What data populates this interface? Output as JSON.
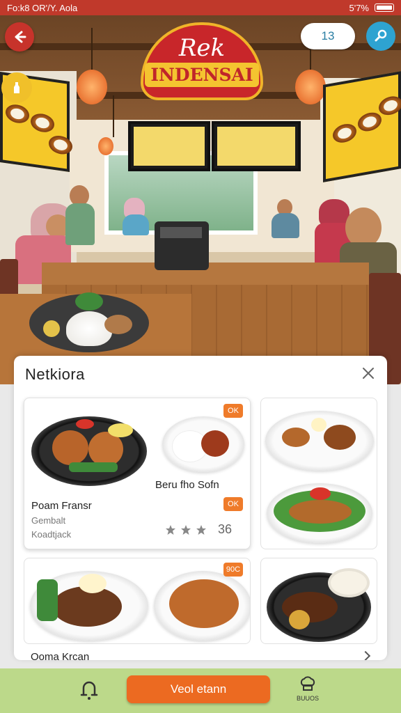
{
  "status_bar": {
    "left_text": "Fo:k8 OR'/Y. Aola",
    "right_text": "5'7%"
  },
  "header": {
    "logo_top": "Rek",
    "logo_bottom": "INDENSAI",
    "count": "13"
  },
  "panel": {
    "title": "Netkiora",
    "cards": [
      {
        "name": "Poam Fransr",
        "sub1": "Gembalt",
        "sub2": "Koadtjack",
        "secondary_name": "Beru fho Sofn",
        "rating": "36",
        "tag1": "OK",
        "tag2": "OK"
      },
      {
        "tag": "90C"
      }
    ],
    "cut_label": "Ooma Krcan"
  },
  "bottom_bar": {
    "order_label": "Veol etann",
    "chef_label": "BUUOS"
  },
  "colors": {
    "accent": "#ec6a21",
    "brand_red": "#c7332b",
    "bottom_bg": "#bcd98a",
    "search_blue": "#2ea3d1"
  },
  "icons": [
    "back-arrow-icon",
    "search-icon",
    "bottle-icon",
    "close-icon",
    "bell-icon",
    "chef-hat-icon",
    "star-icon",
    "chevron-right-icon"
  ]
}
